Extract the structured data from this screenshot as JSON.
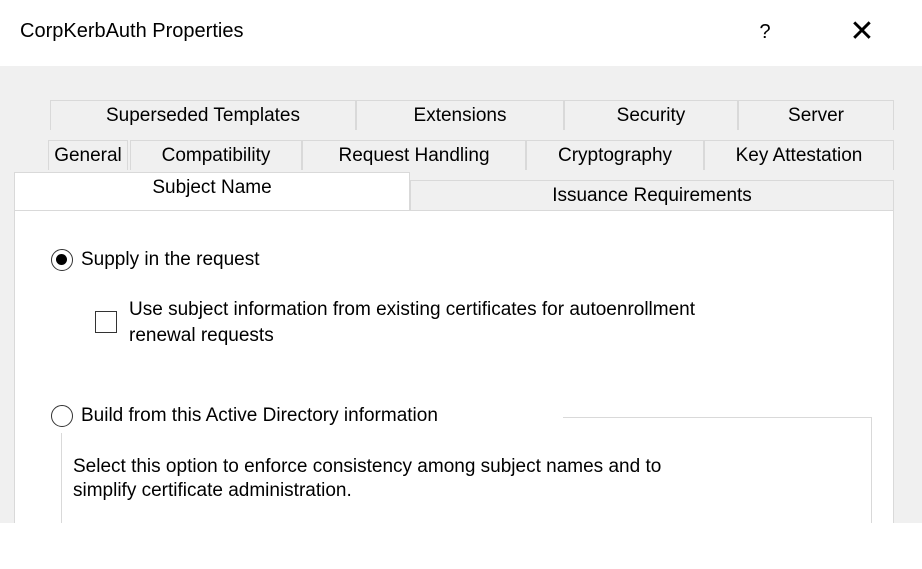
{
  "window": {
    "title": "CorpKerbAuth Properties",
    "help_label": "?",
    "close_label": "✕"
  },
  "tabs": {
    "row1": [
      "Superseded Templates",
      "Extensions",
      "Security",
      "Server"
    ],
    "row2": [
      "General",
      "Compatibility",
      "Request Handling",
      "Cryptography",
      "Key Attestation"
    ],
    "row3": [
      "Subject Name",
      "Issuance Requirements"
    ],
    "active": "Subject Name"
  },
  "subject_name": {
    "supply_label": "Supply in the request",
    "supply_selected": true,
    "autoenroll_label_line1": "Use subject information from existing certificates for autoenrollment",
    "autoenroll_label_line2": "renewal requests",
    "autoenroll_checked": false,
    "build_label": "Build from this Active Directory information",
    "build_selected": false,
    "build_desc_line1": "Select this option to enforce consistency among subject names and to",
    "build_desc_line2": "simplify certificate administration."
  }
}
